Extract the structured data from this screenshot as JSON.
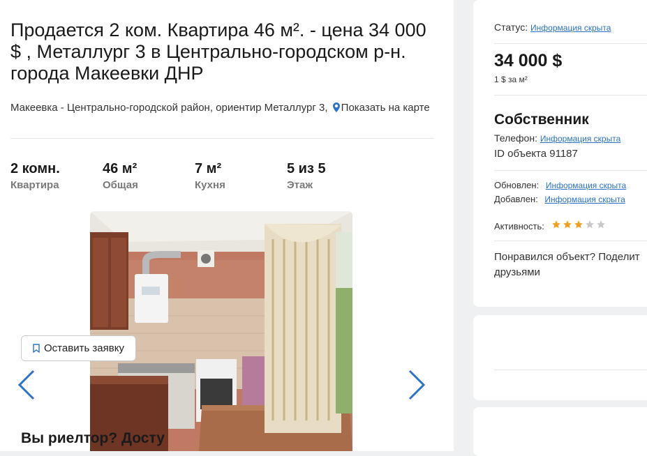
{
  "listing": {
    "title": "Продается 2 ком. Квартира 46 м². - цена 34 000 $ , Металлург 3 в Центрально-городском р-н. города Макеевки ДНР",
    "address": "Макеевка - Центрально-городской район, ориентир Металлург 3,",
    "show_on_map": "Показать на карте",
    "stats": [
      {
        "value": "2 комн.",
        "label": "Квартира"
      },
      {
        "value": "46 м²",
        "label": "Общая"
      },
      {
        "value": "7 м²",
        "label": "Кухня"
      },
      {
        "value": "5 из 5",
        "label": "Этаж"
      }
    ]
  },
  "sidebar": {
    "status_label": "Статус:",
    "status_value": "Информация скрыта",
    "price": "34 000 $",
    "price_per_m2": "1 $ за м²",
    "owner": "Собственник",
    "phone_label": "Телефон:",
    "phone_value": "Информация скрыта",
    "object_id": "ID объекта 91187",
    "updated_label": "Обновлен:",
    "updated_value": "Информация скрыта",
    "added_label": "Добавлен:",
    "added_value": "Информация скрыта",
    "activity_label": "Активность:",
    "activity_rating": 3,
    "activity_max": 5,
    "share_text": "Понравился объект? Поделит друзьями",
    "apply_button": "Оставить заявку",
    "realtor_heading": "Вы риелтор? Досту"
  },
  "colors": {
    "link": "#2b73c8",
    "star_filled": "#f0a020",
    "star_empty": "#c9c9c9",
    "page_bg": "#eef0f2"
  },
  "icons": {
    "map_pin": "map-pin-icon",
    "prev": "chevron-left-icon",
    "next": "chevron-right-icon",
    "bookmark": "bookmark-icon",
    "star": "star-icon"
  }
}
